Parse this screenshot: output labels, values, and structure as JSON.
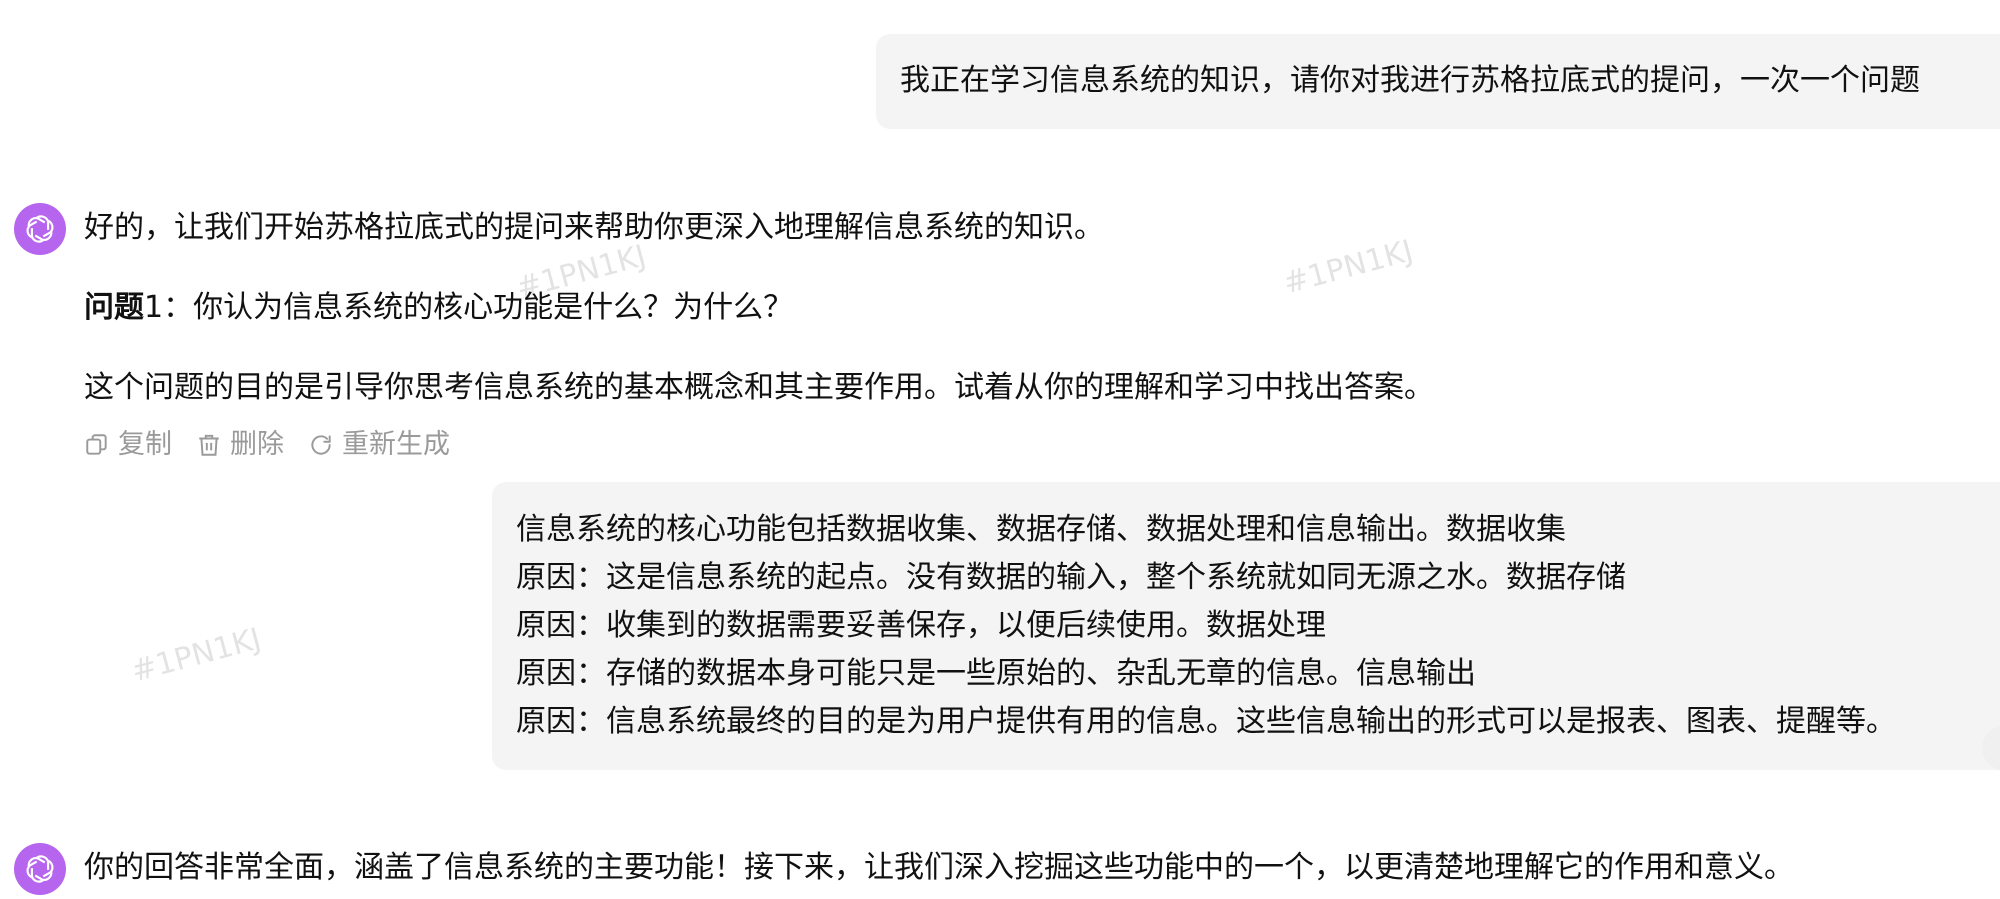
{
  "messages": {
    "user_1": {
      "text": "我正在学习信息系统的知识，请你对我进行苏格拉底式的提问，一次一个问题"
    },
    "assistant_1": {
      "intro": "好的，让我们开始苏格拉底式的提问来帮助你更深入地理解信息系统的知识。",
      "question_label": "问题",
      "question_rest": "1：你认为信息系统的核心功能是什么？为什么？",
      "explanation": "这个问题的目的是引导你思考信息系统的基本概念和其主要作用。试着从你的理解和学习中找出答案。"
    },
    "actions": {
      "copy": "复制",
      "delete": "删除",
      "regenerate": "重新生成"
    },
    "user_2": {
      "lines": [
        "信息系统的核心功能包括数据收集、数据存储、数据处理和信息输出。数据收集",
        "原因：这是信息系统的起点。没有数据的输入，整个系统就如同无源之水。数据存储",
        "原因：收集到的数据需要妥善保存，以便后续使用。数据处理",
        "原因：存储的数据本身可能只是一些原始的、杂乱无章的信息。信息输出",
        "原因：信息系统最终的目的是为用户提供有用的信息。这些信息输出的形式可以是报表、图表、提醒等。"
      ]
    },
    "assistant_2": {
      "text": "你的回答非常全面，涵盖了信息系统的主要功能！接下来，让我们深入挖掘这些功能中的一个，以更清楚地理解它的作用和意义。"
    }
  },
  "watermark_text": "#1PN1KJ",
  "colors": {
    "avatar": "#b666ee",
    "bubble": "#f4f4f4",
    "action_text": "#9a9a9a"
  },
  "icons": [
    "openai-logo-icon",
    "copy-icon",
    "trash-icon",
    "refresh-icon"
  ]
}
